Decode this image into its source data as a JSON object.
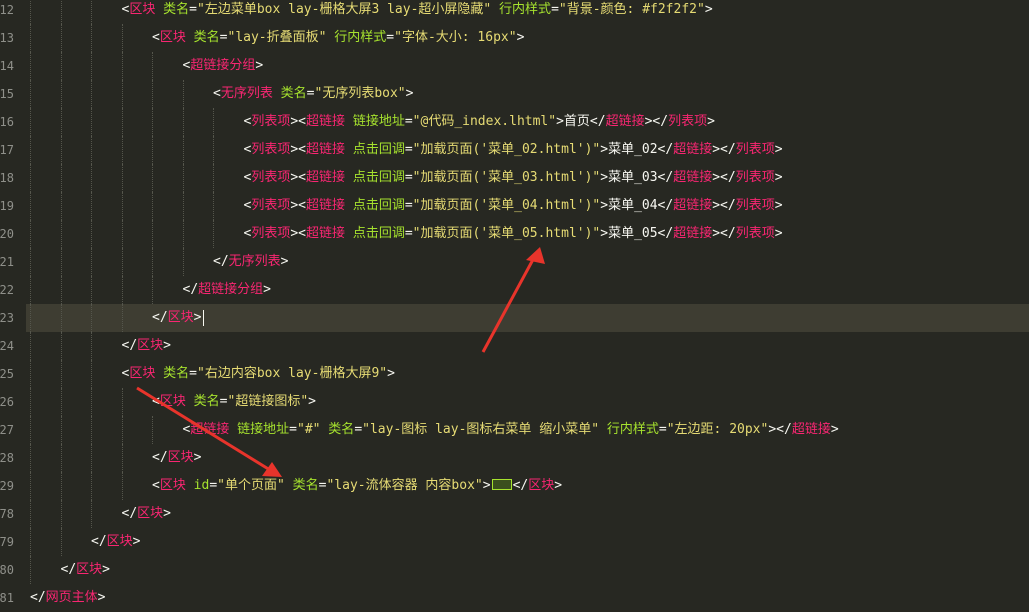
{
  "lines": [
    {
      "num": "12",
      "indent": 5,
      "tokens": [
        {
          "t": "<",
          "c": "punc"
        },
        {
          "t": "区块",
          "c": "tag"
        },
        {
          "t": " 类名",
          "c": "attr"
        },
        {
          "t": "=",
          "c": "punc"
        },
        {
          "t": "\"左边菜单box lay-栅格大屏3 lay-超小屏隐藏\"",
          "c": "str"
        },
        {
          "t": " 行内样式",
          "c": "attr"
        },
        {
          "t": "=",
          "c": "punc"
        },
        {
          "t": "\"背景-颜色: #f2f2f2\"",
          "c": "str"
        },
        {
          "t": ">",
          "c": "punc"
        }
      ]
    },
    {
      "num": "13",
      "indent": 6,
      "tokens": [
        {
          "t": "<",
          "c": "punc"
        },
        {
          "t": "区块",
          "c": "tag"
        },
        {
          "t": " 类名",
          "c": "attr"
        },
        {
          "t": "=",
          "c": "punc"
        },
        {
          "t": "\"lay-折叠面板\"",
          "c": "str"
        },
        {
          "t": " 行内样式",
          "c": "attr"
        },
        {
          "t": "=",
          "c": "punc"
        },
        {
          "t": "\"字体-大小: 16px\"",
          "c": "str"
        },
        {
          "t": ">",
          "c": "punc"
        }
      ]
    },
    {
      "num": "14",
      "indent": 7,
      "tokens": [
        {
          "t": "<",
          "c": "punc"
        },
        {
          "t": "超链接分组",
          "c": "tag"
        },
        {
          "t": ">",
          "c": "punc"
        }
      ]
    },
    {
      "num": "15",
      "indent": 8,
      "tokens": [
        {
          "t": "<",
          "c": "punc"
        },
        {
          "t": "无序列表",
          "c": "tag"
        },
        {
          "t": " 类名",
          "c": "attr"
        },
        {
          "t": "=",
          "c": "punc"
        },
        {
          "t": "\"无序列表box\"",
          "c": "str"
        },
        {
          "t": ">",
          "c": "punc"
        }
      ]
    },
    {
      "num": "16",
      "indent": 9,
      "tokens": [
        {
          "t": "<",
          "c": "punc"
        },
        {
          "t": "列表项",
          "c": "tag"
        },
        {
          "t": "><",
          "c": "punc"
        },
        {
          "t": "超链接",
          "c": "tag"
        },
        {
          "t": " 链接地址",
          "c": "attr"
        },
        {
          "t": "=",
          "c": "punc"
        },
        {
          "t": "\"@代码_index.lhtml\"",
          "c": "str"
        },
        {
          "t": ">首页</",
          "c": "txt"
        },
        {
          "t": "超链接",
          "c": "tag"
        },
        {
          "t": "></",
          "c": "punc"
        },
        {
          "t": "列表项",
          "c": "tag"
        },
        {
          "t": ">",
          "c": "punc"
        }
      ]
    },
    {
      "num": "17",
      "indent": 9,
      "tokens": [
        {
          "t": "<",
          "c": "punc"
        },
        {
          "t": "列表项",
          "c": "tag"
        },
        {
          "t": "><",
          "c": "punc"
        },
        {
          "t": "超链接",
          "c": "tag"
        },
        {
          "t": " 点击回调",
          "c": "attr"
        },
        {
          "t": "=",
          "c": "punc"
        },
        {
          "t": "\"加载页面('菜单_02.html')\"",
          "c": "str"
        },
        {
          "t": ">菜单_02</",
          "c": "txt"
        },
        {
          "t": "超链接",
          "c": "tag"
        },
        {
          "t": "></",
          "c": "punc"
        },
        {
          "t": "列表项",
          "c": "tag"
        },
        {
          "t": ">",
          "c": "punc"
        }
      ]
    },
    {
      "num": "18",
      "indent": 9,
      "tokens": [
        {
          "t": "<",
          "c": "punc"
        },
        {
          "t": "列表项",
          "c": "tag"
        },
        {
          "t": "><",
          "c": "punc"
        },
        {
          "t": "超链接",
          "c": "tag"
        },
        {
          "t": " 点击回调",
          "c": "attr"
        },
        {
          "t": "=",
          "c": "punc"
        },
        {
          "t": "\"加载页面('菜单_03.html')\"",
          "c": "str"
        },
        {
          "t": ">菜单_03</",
          "c": "txt"
        },
        {
          "t": "超链接",
          "c": "tag"
        },
        {
          "t": "></",
          "c": "punc"
        },
        {
          "t": "列表项",
          "c": "tag"
        },
        {
          "t": ">",
          "c": "punc"
        }
      ]
    },
    {
      "num": "19",
      "indent": 9,
      "tokens": [
        {
          "t": "<",
          "c": "punc"
        },
        {
          "t": "列表项",
          "c": "tag"
        },
        {
          "t": "><",
          "c": "punc"
        },
        {
          "t": "超链接",
          "c": "tag"
        },
        {
          "t": " 点击回调",
          "c": "attr"
        },
        {
          "t": "=",
          "c": "punc"
        },
        {
          "t": "\"加载页面('菜单_04.html')\"",
          "c": "str"
        },
        {
          "t": ">菜单_04</",
          "c": "txt"
        },
        {
          "t": "超链接",
          "c": "tag"
        },
        {
          "t": "></",
          "c": "punc"
        },
        {
          "t": "列表项",
          "c": "tag"
        },
        {
          "t": ">",
          "c": "punc"
        }
      ]
    },
    {
      "num": "20",
      "indent": 9,
      "tokens": [
        {
          "t": "<",
          "c": "punc"
        },
        {
          "t": "列表项",
          "c": "tag"
        },
        {
          "t": "><",
          "c": "punc"
        },
        {
          "t": "超链接",
          "c": "tag"
        },
        {
          "t": " 点击回调",
          "c": "attr"
        },
        {
          "t": "=",
          "c": "punc"
        },
        {
          "t": "\"加载页面('菜单_05.html')\"",
          "c": "str"
        },
        {
          "t": ">菜单_05</",
          "c": "txt"
        },
        {
          "t": "超链接",
          "c": "tag"
        },
        {
          "t": "></",
          "c": "punc"
        },
        {
          "t": "列表项",
          "c": "tag"
        },
        {
          "t": ">",
          "c": "punc"
        }
      ]
    },
    {
      "num": "21",
      "indent": 8,
      "tokens": [
        {
          "t": "</",
          "c": "punc"
        },
        {
          "t": "无序列表",
          "c": "tag"
        },
        {
          "t": ">",
          "c": "punc"
        }
      ]
    },
    {
      "num": "22",
      "indent": 7,
      "tokens": [
        {
          "t": "</",
          "c": "punc"
        },
        {
          "t": "超链接分组",
          "c": "tag"
        },
        {
          "t": ">",
          "c": "punc"
        }
      ]
    },
    {
      "num": "23",
      "indent": 6,
      "current": true,
      "caret": true,
      "tokens": [
        {
          "t": "</",
          "c": "punc"
        },
        {
          "t": "区块",
          "c": "tag"
        },
        {
          "t": ">",
          "c": "punc"
        }
      ]
    },
    {
      "num": "24",
      "indent": 5,
      "tokens": [
        {
          "t": "</",
          "c": "punc"
        },
        {
          "t": "区块",
          "c": "tag"
        },
        {
          "t": ">",
          "c": "punc"
        }
      ]
    },
    {
      "num": "25",
      "indent": 5,
      "tokens": [
        {
          "t": "<",
          "c": "punc"
        },
        {
          "t": "区块",
          "c": "tag"
        },
        {
          "t": " 类名",
          "c": "attr"
        },
        {
          "t": "=",
          "c": "punc"
        },
        {
          "t": "\"右边内容box lay-栅格大屏9\"",
          "c": "str"
        },
        {
          "t": ">",
          "c": "punc"
        }
      ]
    },
    {
      "num": "26",
      "indent": 6,
      "tokens": [
        {
          "t": "<",
          "c": "punc"
        },
        {
          "t": "区块",
          "c": "tag"
        },
        {
          "t": " 类名",
          "c": "attr"
        },
        {
          "t": "=",
          "c": "punc"
        },
        {
          "t": "\"超链接图标\"",
          "c": "str"
        },
        {
          "t": ">",
          "c": "punc"
        }
      ]
    },
    {
      "num": "27",
      "indent": 7,
      "tokens": [
        {
          "t": "<",
          "c": "punc"
        },
        {
          "t": "超链接",
          "c": "tag"
        },
        {
          "t": " 链接地址",
          "c": "attr"
        },
        {
          "t": "=",
          "c": "punc"
        },
        {
          "t": "\"#\"",
          "c": "str"
        },
        {
          "t": " 类名",
          "c": "attr"
        },
        {
          "t": "=",
          "c": "punc"
        },
        {
          "t": "\"lay-图标 lay-图标右菜单 缩小菜单\"",
          "c": "str"
        },
        {
          "t": " 行内样式",
          "c": "attr"
        },
        {
          "t": "=",
          "c": "punc"
        },
        {
          "t": "\"左边距: 20px\"",
          "c": "str"
        },
        {
          "t": "></",
          "c": "punc"
        },
        {
          "t": "超链接",
          "c": "tag"
        },
        {
          "t": ">",
          "c": "punc"
        }
      ]
    },
    {
      "num": "28",
      "indent": 6,
      "tokens": [
        {
          "t": "</",
          "c": "punc"
        },
        {
          "t": "区块",
          "c": "tag"
        },
        {
          "t": ">",
          "c": "punc"
        }
      ]
    },
    {
      "num": "29",
      "indent": 6,
      "fold": true,
      "tokens": [
        {
          "t": "<",
          "c": "punc"
        },
        {
          "t": "区块",
          "c": "tag"
        },
        {
          "t": " id",
          "c": "attr"
        },
        {
          "t": "=",
          "c": "punc"
        },
        {
          "t": "\"单个页面\"",
          "c": "str"
        },
        {
          "t": " 类名",
          "c": "attr"
        },
        {
          "t": "=",
          "c": "punc"
        },
        {
          "t": "\"lay-流体容器 内容box\"",
          "c": "str"
        },
        {
          "t": ">",
          "c": "punc"
        },
        {
          "t": "[[FOLD]]",
          "c": "fold"
        },
        {
          "t": "</",
          "c": "punc"
        },
        {
          "t": "区块",
          "c": "tag"
        },
        {
          "t": ">",
          "c": "punc"
        }
      ]
    },
    {
      "num": "78",
      "indent": 5,
      "tokens": [
        {
          "t": "</",
          "c": "punc"
        },
        {
          "t": "区块",
          "c": "tag"
        },
        {
          "t": ">",
          "c": "punc"
        }
      ]
    },
    {
      "num": "79",
      "indent": 4,
      "tokens": [
        {
          "t": "</",
          "c": "punc"
        },
        {
          "t": "区块",
          "c": "tag"
        },
        {
          "t": ">",
          "c": "punc"
        }
      ]
    },
    {
      "num": "80",
      "indent": 3,
      "tokens": [
        {
          "t": "</",
          "c": "punc"
        },
        {
          "t": "区块",
          "c": "tag"
        },
        {
          "t": ">",
          "c": "punc"
        }
      ]
    },
    {
      "num": "81",
      "indent": 2,
      "tokens": [
        {
          "t": "</",
          "c": "punc"
        },
        {
          "t": "网页主体",
          "c": "tag"
        },
        {
          "t": ">",
          "c": "punc"
        }
      ]
    }
  ],
  "colors": {
    "background": "#272822",
    "tag": "#f92672",
    "attribute": "#a6e22e",
    "string": "#e6db74",
    "text": "#f8f8f2",
    "line_number": "#8f908a",
    "current_line": "#3e3d32",
    "annotation_arrow": "#e8342b"
  },
  "annotations": [
    {
      "type": "arrow",
      "icon": "red-arrow-icon",
      "points_to": "菜单_05.html"
    },
    {
      "type": "arrow",
      "icon": "red-arrow-icon",
      "points_to": "单个页面"
    }
  ]
}
